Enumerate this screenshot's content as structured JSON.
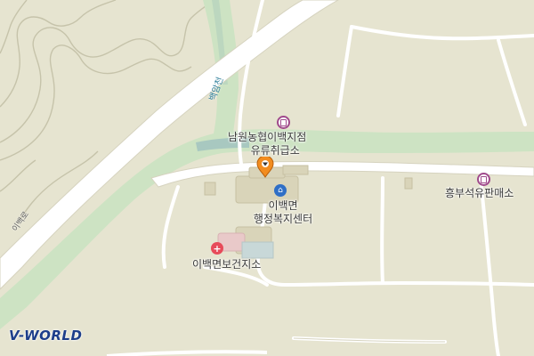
{
  "map": {
    "labels": {
      "nonghyup_station": "남원농협이백지점",
      "nonghyup_station_2": "유류취급소",
      "myeon_office_1": "이백면",
      "myeon_office_2": "행정복지센터",
      "health_center": "이백면보건지소",
      "heungbu_station": "흥부석유판매소",
      "stream": "백암천",
      "road": "이백로"
    },
    "icons": {
      "fuel": "fuel-pump-icon",
      "admin": "house-icon",
      "health": "red-cross-icon",
      "pin": "location-pin-icon"
    },
    "colors": {
      "land": "#e6e4d0",
      "stream": "#cde3c3",
      "river": "#a8c8c0",
      "road": "#ffffff",
      "road_edge": "#d6d3bf",
      "fuel": "#a04a8c",
      "admin": "#2f6fc6",
      "health": "#e74b5a",
      "pin": "#f28c1f"
    }
  },
  "branding": {
    "logo": "V-WORLD"
  }
}
